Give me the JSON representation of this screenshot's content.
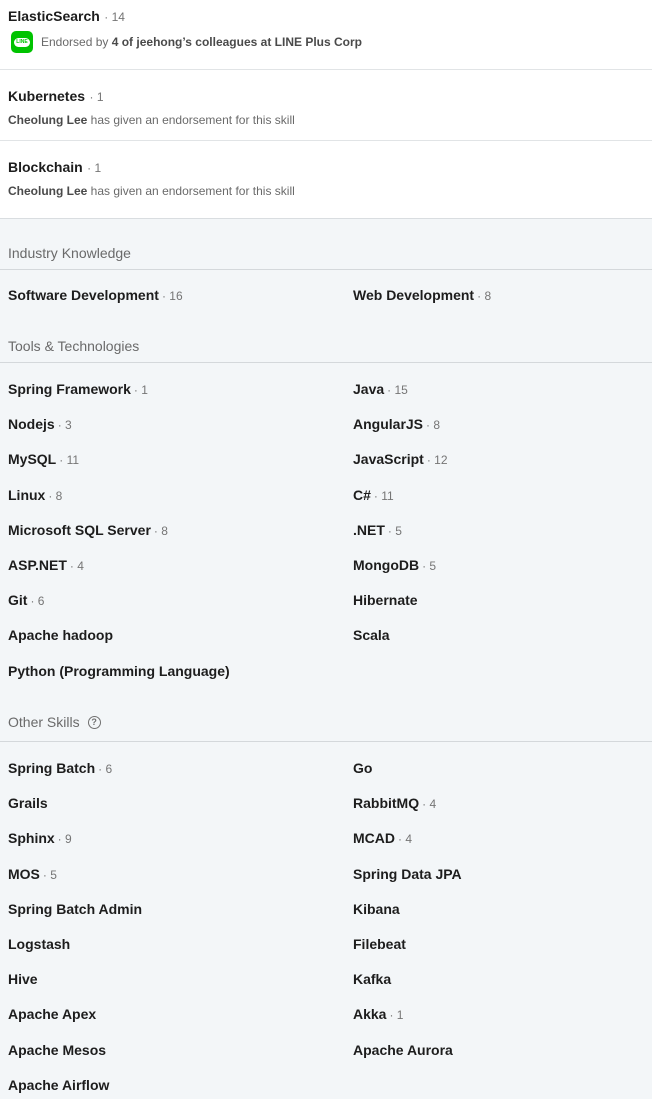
{
  "top_skills": [
    {
      "name": "ElasticSearch",
      "count": "· 14",
      "endorse_prefix": "Endorsed by ",
      "endorse_bold": "4 of jeehong’s colleagues at LINE Plus Corp",
      "logo_text": "LINE"
    },
    {
      "name": "Kubernetes",
      "count": "· 1",
      "endorser": "Cheolung Lee",
      "endorse_text": " has given an endorsement for this skill"
    },
    {
      "name": "Blockchain",
      "count": "· 1",
      "endorser": "Cheolung Lee",
      "endorse_text": " has given an endorsement for this skill"
    }
  ],
  "industry": {
    "title": "Industry Knowledge",
    "skills": [
      {
        "name": "Software Development",
        "count": "· 16"
      },
      {
        "name": "Web Development",
        "count": "· 8"
      }
    ]
  },
  "tools": {
    "title": "Tools & Technologies",
    "skills": [
      {
        "name": "Spring Framework",
        "count": "· 1"
      },
      {
        "name": "Java",
        "count": "· 15"
      },
      {
        "name": "Nodejs",
        "count": "· 3"
      },
      {
        "name": "AngularJS",
        "count": "· 8"
      },
      {
        "name": "MySQL",
        "count": "· 11"
      },
      {
        "name": "JavaScript",
        "count": "· 12"
      },
      {
        "name": "Linux",
        "count": "· 8"
      },
      {
        "name": "C#",
        "count": "· 11"
      },
      {
        "name": "Microsoft SQL Server",
        "count": "· 8"
      },
      {
        "name": ".NET",
        "count": "· 5"
      },
      {
        "name": "ASP.NET",
        "count": "· 4"
      },
      {
        "name": "MongoDB",
        "count": "· 5"
      },
      {
        "name": "Git",
        "count": "· 6"
      },
      {
        "name": "Hibernate",
        "count": ""
      },
      {
        "name": "Apache hadoop",
        "count": ""
      },
      {
        "name": "Scala",
        "count": ""
      },
      {
        "name": "Python (Programming Language)",
        "count": ""
      }
    ]
  },
  "other": {
    "title": "Other Skills",
    "help_glyph": "?",
    "skills": [
      {
        "name": "Spring Batch",
        "count": "· 6"
      },
      {
        "name": "Go",
        "count": ""
      },
      {
        "name": "Grails",
        "count": ""
      },
      {
        "name": "RabbitMQ",
        "count": "· 4"
      },
      {
        "name": "Sphinx",
        "count": "· 9"
      },
      {
        "name": "MCAD",
        "count": "· 4"
      },
      {
        "name": "MOS",
        "count": "· 5"
      },
      {
        "name": "Spring Data JPA",
        "count": ""
      },
      {
        "name": "Spring Batch Admin",
        "count": ""
      },
      {
        "name": "Kibana",
        "count": ""
      },
      {
        "name": "Logstash",
        "count": ""
      },
      {
        "name": "Filebeat",
        "count": ""
      },
      {
        "name": "Hive",
        "count": ""
      },
      {
        "name": "Kafka",
        "count": ""
      },
      {
        "name": "Apache Apex",
        "count": ""
      },
      {
        "name": "Akka",
        "count": "· 1"
      },
      {
        "name": "Apache Mesos",
        "count": ""
      },
      {
        "name": "Apache Aurora",
        "count": ""
      },
      {
        "name": "Apache Airflow",
        "count": ""
      }
    ]
  }
}
